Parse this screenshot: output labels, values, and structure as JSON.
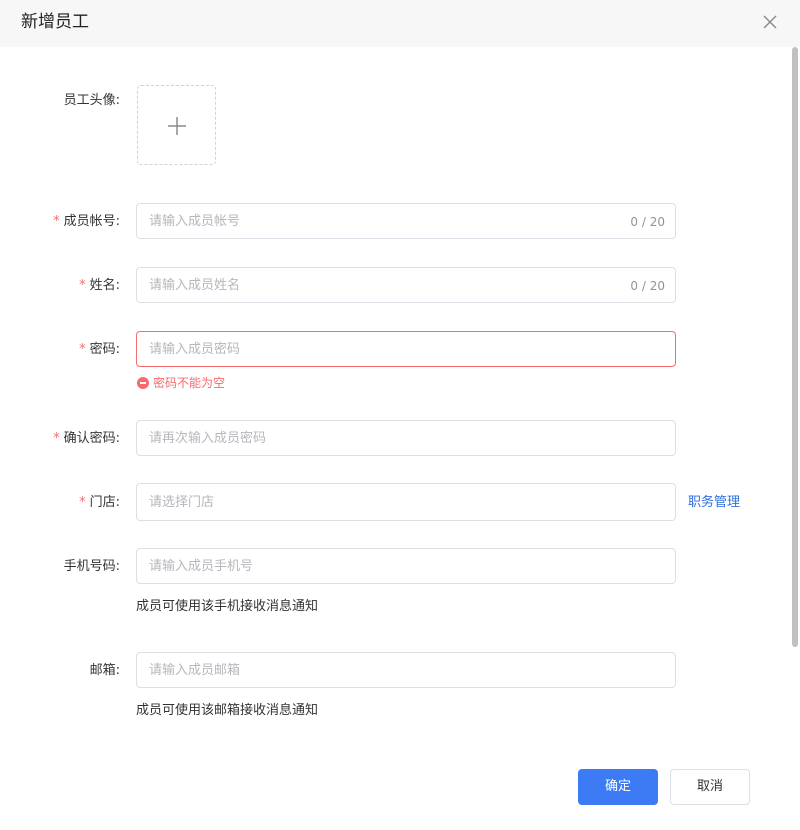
{
  "dialog": {
    "title": "新增员工"
  },
  "form": {
    "avatar_label": "员工头像:",
    "account": {
      "label": "成员帐号:",
      "placeholder": "请输入成员帐号",
      "counter": "0 / 20",
      "required": "*"
    },
    "name": {
      "label": "姓名:",
      "placeholder": "请输入成员姓名",
      "counter": "0 / 20",
      "required": "*"
    },
    "password": {
      "label": "密码:",
      "placeholder": "请输入成员密码",
      "error": "密码不能为空",
      "required": "*"
    },
    "confirm_password": {
      "label": "确认密码:",
      "placeholder": "请再次输入成员密码",
      "required": "*"
    },
    "store": {
      "label": "门店:",
      "placeholder": "请选择门店",
      "link": "职务管理",
      "required": "*"
    },
    "phone": {
      "label": "手机号码:",
      "placeholder": "请输入成员手机号",
      "hint": "成员可使用该手机接收消息通知"
    },
    "email": {
      "label": "邮箱:",
      "placeholder": "请输入成员邮箱",
      "hint": "成员可使用该邮箱接收消息通知"
    }
  },
  "footer": {
    "confirm_label": "确定",
    "cancel_label": "取消"
  },
  "icons": {
    "close": "close-icon",
    "upload": "plus-icon",
    "error": "error-circle-icon"
  },
  "colors": {
    "primary": "#3d7bf5",
    "error": "#f56c6c",
    "link": "#2b6fe0"
  }
}
